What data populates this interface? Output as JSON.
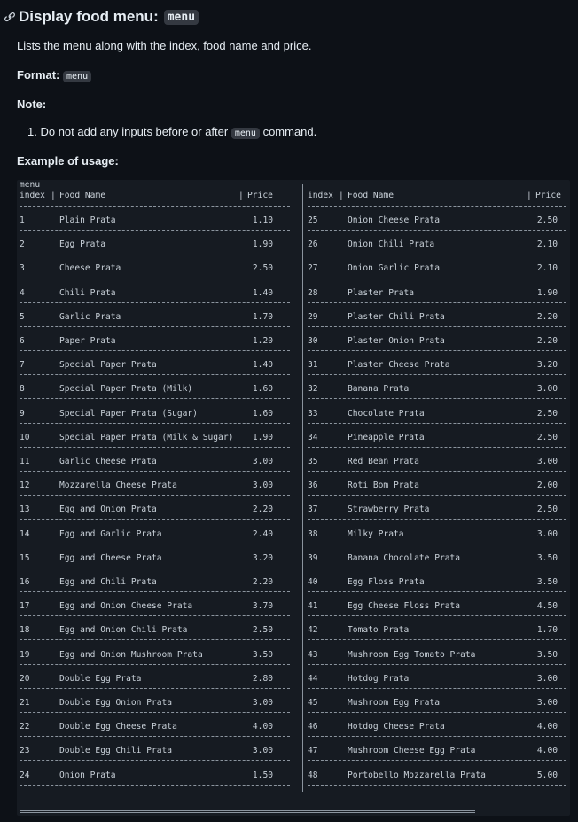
{
  "heading": {
    "text": "Display food menu:",
    "code": "menu",
    "icon": "link-icon"
  },
  "description": "Lists the menu along with the index, food name and price.",
  "format": {
    "label": "Format:",
    "code": "menu"
  },
  "note_label": "Note:",
  "note_item": {
    "number": "1.",
    "before": "Do not add any inputs before or after",
    "code": "menu",
    "after": "command."
  },
  "example_label": "Example of usage:",
  "code_block": {
    "command": "menu",
    "headers": {
      "index": "index",
      "name": "Food Name",
      "price": "Price"
    },
    "left_items": [
      {
        "index": "1",
        "name": "Plain Prata",
        "price": "1.10"
      },
      {
        "index": "2",
        "name": "Egg Prata",
        "price": "1.90"
      },
      {
        "index": "3",
        "name": "Cheese Prata",
        "price": "2.50"
      },
      {
        "index": "4",
        "name": "Chili Prata",
        "price": "1.40"
      },
      {
        "index": "5",
        "name": "Garlic Prata",
        "price": "1.70"
      },
      {
        "index": "6",
        "name": "Paper Prata",
        "price": "1.20"
      },
      {
        "index": "7",
        "name": "Special Paper Prata",
        "price": "1.40"
      },
      {
        "index": "8",
        "name": "Special Paper Prata (Milk)",
        "price": "1.60"
      },
      {
        "index": "9",
        "name": "Special Paper Prata (Sugar)",
        "price": "1.60"
      },
      {
        "index": "10",
        "name": "Special Paper Prata (Milk & Sugar)",
        "price": "1.90"
      },
      {
        "index": "11",
        "name": "Garlic Cheese Prata",
        "price": "3.00"
      },
      {
        "index": "12",
        "name": "Mozzarella Cheese Prata",
        "price": "3.00"
      },
      {
        "index": "13",
        "name": "Egg and Onion Prata",
        "price": "2.20"
      },
      {
        "index": "14",
        "name": "Egg and Garlic Prata",
        "price": "2.40"
      },
      {
        "index": "15",
        "name": "Egg and Cheese Prata",
        "price": "3.20"
      },
      {
        "index": "16",
        "name": "Egg and Chili Prata",
        "price": "2.20"
      },
      {
        "index": "17",
        "name": "Egg and Onion Cheese Prata",
        "price": "3.70"
      },
      {
        "index": "18",
        "name": "Egg and Onion Chili Prata",
        "price": "2.50"
      },
      {
        "index": "19",
        "name": "Egg and Onion Mushroom Prata",
        "price": "3.50"
      },
      {
        "index": "20",
        "name": "Double Egg Prata",
        "price": "2.80"
      },
      {
        "index": "21",
        "name": "Double Egg Onion Prata",
        "price": "3.00"
      },
      {
        "index": "22",
        "name": "Double Egg Cheese Prata",
        "price": "4.00"
      },
      {
        "index": "23",
        "name": "Double Egg Chili Prata",
        "price": "3.00"
      },
      {
        "index": "24",
        "name": "Onion Prata",
        "price": "1.50"
      }
    ],
    "right_items": [
      {
        "index": "25",
        "name": "Onion Cheese Prata",
        "price": "2.50"
      },
      {
        "index": "26",
        "name": "Onion Chili Prata",
        "price": "2.10"
      },
      {
        "index": "27",
        "name": "Onion Garlic Prata",
        "price": "2.10"
      },
      {
        "index": "28",
        "name": "Plaster Prata",
        "price": "1.90"
      },
      {
        "index": "29",
        "name": "Plaster Chili Prata",
        "price": "2.20"
      },
      {
        "index": "30",
        "name": "Plaster Onion Prata",
        "price": "2.20"
      },
      {
        "index": "31",
        "name": "Plaster Cheese Prata",
        "price": "3.20"
      },
      {
        "index": "32",
        "name": "Banana Prata",
        "price": "3.00"
      },
      {
        "index": "33",
        "name": "Chocolate Prata",
        "price": "2.50"
      },
      {
        "index": "34",
        "name": "Pineapple Prata",
        "price": "2.50"
      },
      {
        "index": "35",
        "name": "Red Bean Prata",
        "price": "3.00"
      },
      {
        "index": "36",
        "name": "Roti Bom Prata",
        "price": "2.00"
      },
      {
        "index": "37",
        "name": "Strawberry Prata",
        "price": "2.50"
      },
      {
        "index": "38",
        "name": "Milky Prata",
        "price": "3.00"
      },
      {
        "index": "39",
        "name": "Banana Chocolate Prata",
        "price": "3.50"
      },
      {
        "index": "40",
        "name": "Egg Floss Prata",
        "price": "3.50"
      },
      {
        "index": "41",
        "name": "Egg Cheese Floss Prata",
        "price": "4.50"
      },
      {
        "index": "42",
        "name": "Tomato Prata",
        "price": "1.70"
      },
      {
        "index": "43",
        "name": "Mushroom Egg Tomato Prata",
        "price": "3.50"
      },
      {
        "index": "44",
        "name": "Hotdog Prata",
        "price": "3.00"
      },
      {
        "index": "45",
        "name": "Mushroom Egg Prata",
        "price": "3.00"
      },
      {
        "index": "46",
        "name": "Hotdog Cheese Prata",
        "price": "4.00"
      },
      {
        "index": "47",
        "name": "Mushroom Cheese Egg Prata",
        "price": "4.00"
      },
      {
        "index": "48",
        "name": "Portobello Mozzarella Prata",
        "price": "5.00"
      }
    ]
  }
}
